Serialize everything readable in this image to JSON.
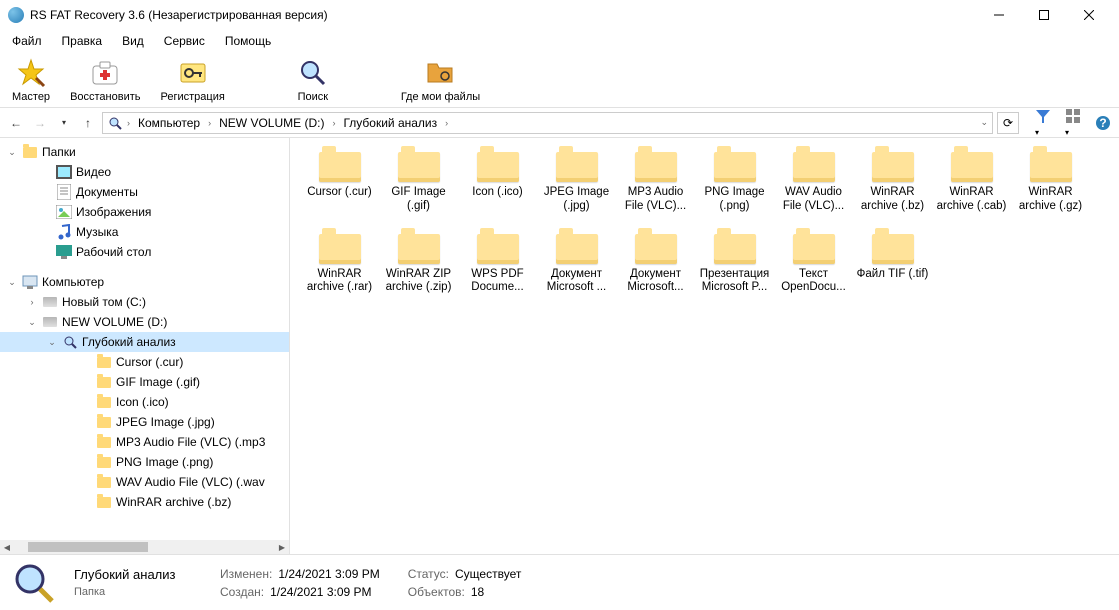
{
  "window": {
    "title": "RS FAT Recovery 3.6 (Незарегистрированная версия)"
  },
  "menu": {
    "items": [
      "Файл",
      "Правка",
      "Вид",
      "Сервис",
      "Помощь"
    ]
  },
  "toolbar": {
    "wizard": "Мастер",
    "recover": "Восстановить",
    "register": "Регистрация",
    "search": "Поиск",
    "where": "Где мои файлы"
  },
  "breadcrumb": {
    "parts": [
      "Компьютер",
      "NEW VOLUME (D:)",
      "Глубокий анализ"
    ]
  },
  "tree": {
    "root1": {
      "label": "Папки"
    },
    "root1_items": [
      {
        "label": "Видео",
        "type": "video"
      },
      {
        "label": "Документы",
        "type": "doc"
      },
      {
        "label": "Изображения",
        "type": "image"
      },
      {
        "label": "Музыка",
        "type": "music"
      },
      {
        "label": "Рабочий стол",
        "type": "desktop"
      }
    ],
    "root2": {
      "label": "Компьютер"
    },
    "root2_items": [
      {
        "label": "Новый том (C:)",
        "expander": ">"
      },
      {
        "label": "NEW VOLUME (D:)",
        "expander": "v",
        "children": [
          {
            "label": "Глубокий анализ",
            "expander": "v",
            "selected": true,
            "children": [
              {
                "label": "Cursor (.cur)"
              },
              {
                "label": "GIF Image (.gif)"
              },
              {
                "label": "Icon (.ico)"
              },
              {
                "label": "JPEG Image (.jpg)"
              },
              {
                "label": "MP3 Audio File (VLC) (.mp3"
              },
              {
                "label": "PNG Image (.png)"
              },
              {
                "label": "WAV Audio File (VLC) (.wav"
              },
              {
                "label": "WinRAR archive (.bz)"
              }
            ]
          }
        ]
      }
    ]
  },
  "grid": {
    "items": [
      "Cursor (.cur)",
      "GIF Image (.gif)",
      "Icon (.ico)",
      "JPEG Image (.jpg)",
      "MP3 Audio File (VLC)...",
      "PNG Image (.png)",
      "WAV Audio File (VLC)...",
      "WinRAR archive (.bz)",
      "WinRAR archive (.cab)",
      "WinRAR archive (.gz)",
      "WinRAR archive (.rar)",
      "WinRAR ZIP archive (.zip)",
      "WPS PDF Docume...",
      "Документ Microsoft ...",
      "Документ Microsoft...",
      "Презентация Microsoft P...",
      "Текст OpenDocu...",
      "Файл TIF (.tif)"
    ]
  },
  "status": {
    "title": "Глубокий анализ",
    "subtitle": "Папка",
    "modified_label": "Изменен:",
    "modified_val": "1/24/2021 3:09 PM",
    "created_label": "Создан:",
    "created_val": "1/24/2021 3:09 PM",
    "status_label": "Статус:",
    "status_val": "Существует",
    "objects_label": "Объектов:",
    "objects_val": "18"
  }
}
